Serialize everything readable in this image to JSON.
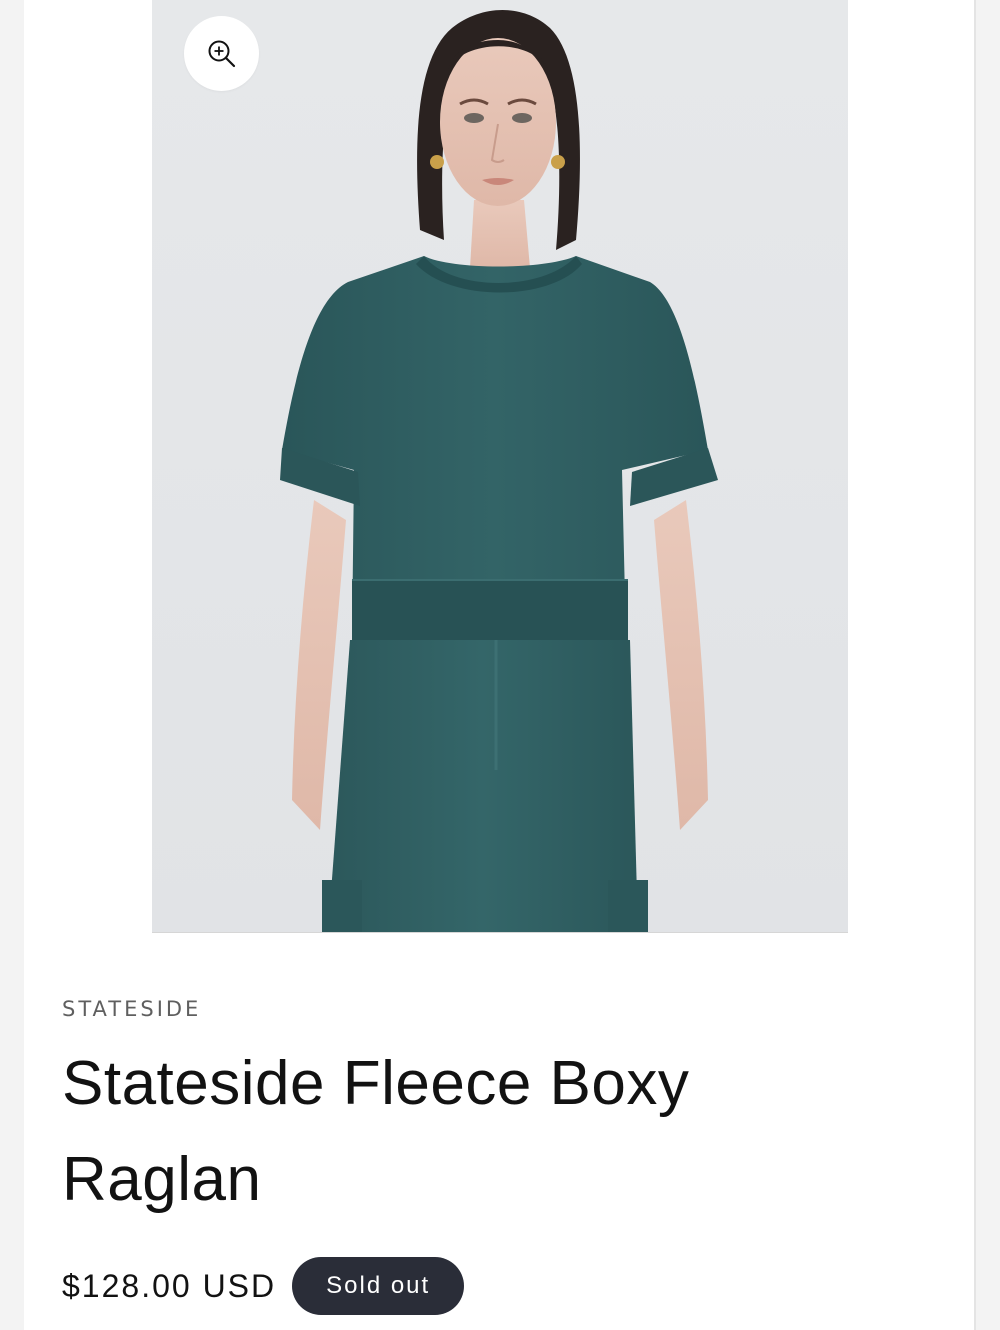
{
  "product": {
    "vendor": "STATESIDE",
    "title": "Stateside Fleece Boxy Raglan",
    "price": "$128.00 USD",
    "badge": "Sold out"
  },
  "media": {
    "image_alt": "Model wearing teal boxy raglan top with cuffed sleeves and matching cargo pants",
    "zoom_icon": "zoom-in-icon"
  },
  "colors": {
    "garment": "#2f5f62",
    "badge_bg": "#2a2d38",
    "image_bg": "#e3e5e8"
  }
}
